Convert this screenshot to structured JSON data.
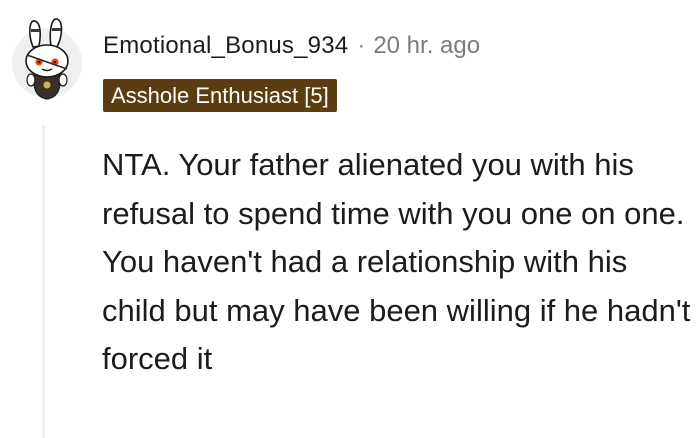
{
  "comment": {
    "username": "Emotional_Bonus_934",
    "separator": "·",
    "timestamp": "20 hr. ago",
    "flair": "Asshole Enthusiast [5]",
    "body": "NTA. Your father alienated you with his refusal to spend time with you one on one. You haven't had a relationship with his child but may have been willing if he hadn't forced it"
  },
  "colors": {
    "flair_background": "#5c3d12",
    "flair_text": "#ffffff",
    "username": "#1c1c1c",
    "timestamp": "#7c7c7c",
    "thread_line": "#edeff1",
    "avatar_background": "#ffffff"
  },
  "icons": {
    "avatar": "snoo-bunny-avatar-icon"
  }
}
